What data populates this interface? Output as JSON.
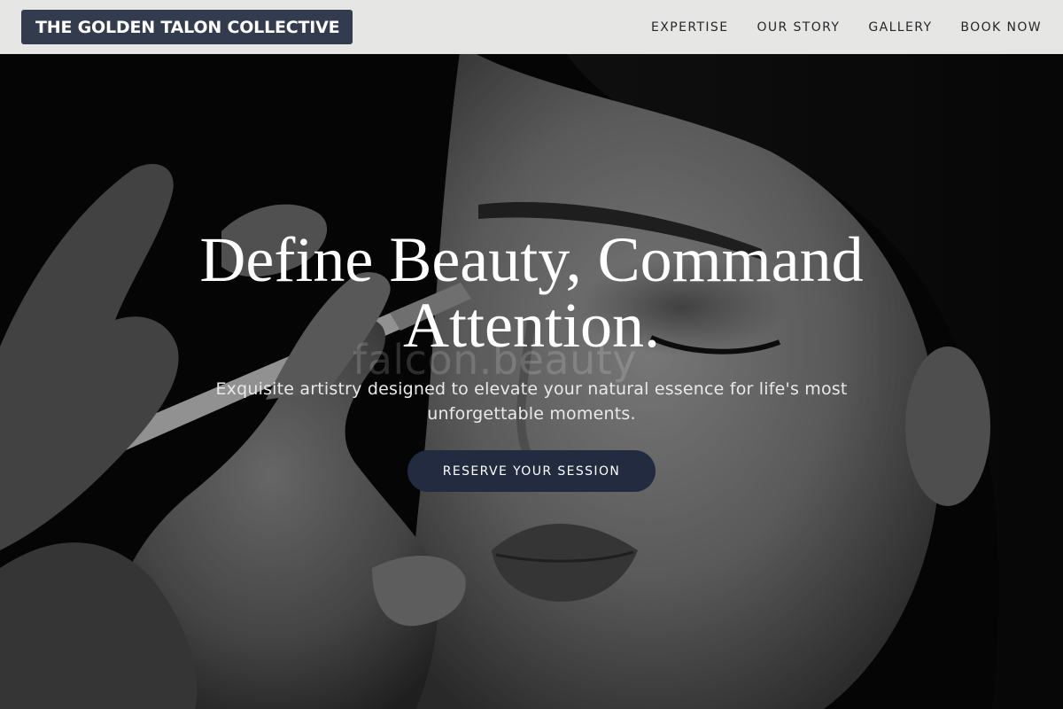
{
  "header": {
    "brand": "THE GOLDEN TALON COLLECTIVE",
    "nav": [
      {
        "label": "EXPERTISE"
      },
      {
        "label": "OUR STORY"
      },
      {
        "label": "GALLERY"
      },
      {
        "label": "BOOK NOW"
      }
    ]
  },
  "hero": {
    "title_line1": "Define Beauty, Command",
    "title_line2": "Attention.",
    "subtitle_line1": "Exquisite artistry designed to elevate your natural essence for life's most",
    "subtitle_line2": "unforgettable moments.",
    "cta_label": "RESERVE YOUR SESSION",
    "watermark": "falcon.beauty"
  },
  "colors": {
    "header_bg": "#e6e6e5",
    "brand_bg": "#333b4f",
    "cta_bg": "#222b40"
  }
}
